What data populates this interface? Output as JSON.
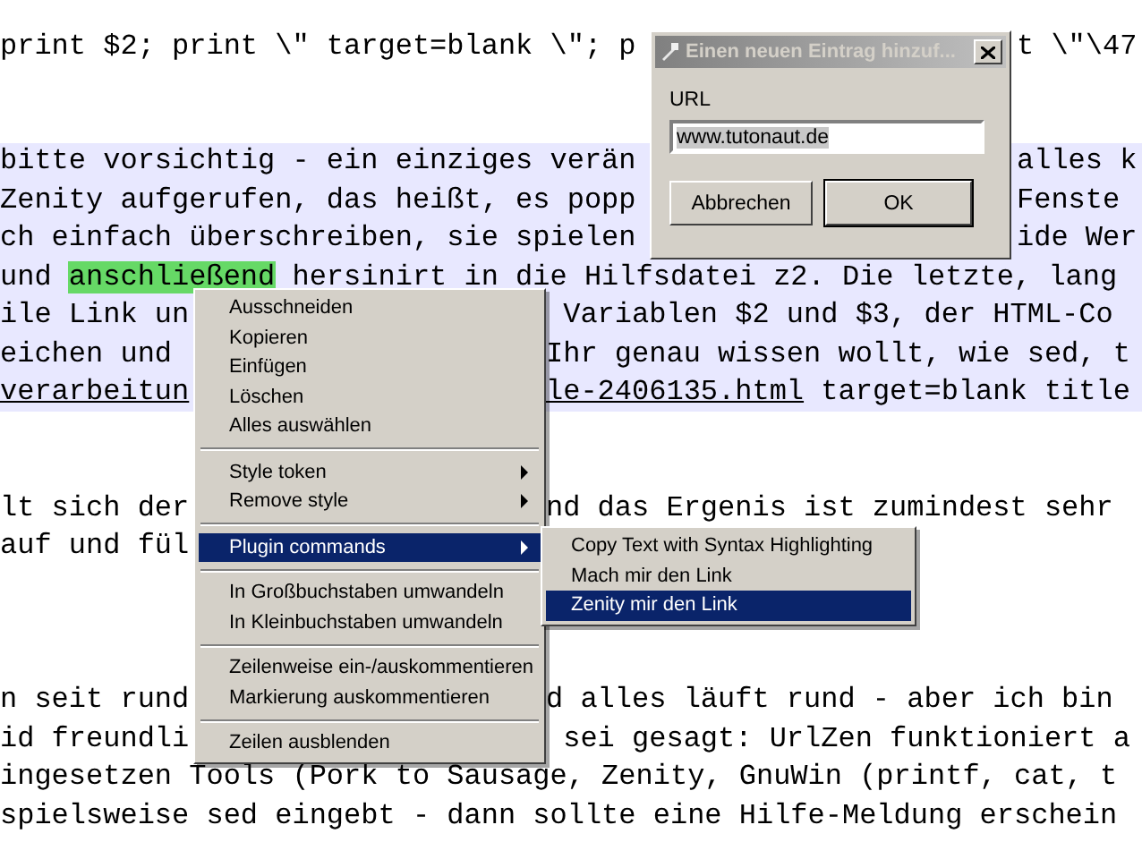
{
  "editor": {
    "lines": [
      {
        "marked": false,
        "parts": [
          {
            "text": "print $2; print \\\" target=blank \\\"; p",
            "kind": "text"
          }
        ],
        "right": [
          {
            "text": "t \\\"\\47",
            "kind": "text"
          }
        ]
      },
      {
        "marked": false
      },
      {
        "marked": false
      },
      {
        "marked": true,
        "parts": [
          {
            "text": "bitte vorsichtig - ein einziges verän",
            "kind": "text"
          }
        ],
        "right": [
          {
            "text": "alles k",
            "kind": "text"
          }
        ]
      },
      {
        "marked": true,
        "parts": [
          {
            "text": "Zenity aufgerufen, das heißt, es popp",
            "kind": "text"
          }
        ],
        "right": [
          {
            "text": "Fenste",
            "kind": "text"
          }
        ]
      },
      {
        "marked": true,
        "parts": [
          {
            "text": "ch einfach überschreiben, sie spielen",
            "kind": "text"
          }
        ],
        "right": [
          {
            "text": "ide Wer",
            "kind": "text"
          }
        ]
      },
      {
        "marked": true,
        "parts": [
          {
            "text": "und ",
            "kind": "text"
          },
          {
            "text": "anschließend",
            "kind": "token"
          },
          {
            "text": " hersinirt in die Hilfsdatei z2. Die letzte, lang",
            "kind": "text"
          }
        ]
      },
      {
        "marked": true,
        "parts": [
          {
            "text": "ile Link un",
            "kind": "text"
          }
        ],
        "right": [
          {
            "text": " Variablen $2 und $3, der HTML-Co",
            "kind": "text"
          }
        ]
      },
      {
        "marked": true,
        "parts": [
          {
            "text": "eichen und",
            "kind": "text"
          }
        ],
        "right": [
          {
            "text": "Ihr genau wissen wollt, wie sed, t",
            "kind": "text"
          }
        ]
      },
      {
        "marked": true,
        "parts": [
          {
            "text": "verarbeitun",
            "kind": "link"
          }
        ],
        "right": [
          {
            "text": "le-2406135.html",
            "kind": "link"
          },
          {
            "text": " target=blank title",
            "kind": "text"
          }
        ]
      },
      {
        "marked": false
      },
      {
        "marked": false
      },
      {
        "marked": false,
        "parts": [
          {
            "text": "lt sich der",
            "kind": "text"
          }
        ],
        "right": [
          {
            "text": "nd das Ergenis ist zumindest sehr",
            "kind": "text"
          }
        ]
      },
      {
        "marked": false,
        "parts": [
          {
            "text": "auf und fül",
            "kind": "text"
          }
        ]
      },
      {
        "marked": false
      },
      {
        "marked": false
      },
      {
        "marked": false
      },
      {
        "marked": false,
        "parts": [
          {
            "text": "n seit rund",
            "kind": "text"
          }
        ],
        "right": [
          {
            "text": "d alles läuft rund - aber ich bin",
            "kind": "text"
          }
        ]
      },
      {
        "marked": false,
        "parts": [
          {
            "text": "id freundli",
            "kind": "text"
          }
        ],
        "right": [
          {
            "text": " sei gesagt: UrlZen funktioniert a",
            "kind": "text"
          }
        ]
      },
      {
        "marked": false,
        "parts": [
          {
            "text": "ingesetzen Tools (Pork to Sausage, Zenity, GnuWin (printf, cat, t",
            "kind": "text"
          }
        ]
      },
      {
        "marked": false,
        "parts": [
          {
            "text": "spielsweise sed eingebt - dann sollte eine Hilfe-Meldung erschein",
            "kind": "text"
          }
        ]
      }
    ]
  },
  "context_menu": {
    "items": [
      {
        "kind": "item",
        "label": "Ausschneiden",
        "submenu": false,
        "selected": false
      },
      {
        "kind": "item",
        "label": "Kopieren",
        "submenu": false,
        "selected": false
      },
      {
        "kind": "item",
        "label": "Einfügen",
        "submenu": false,
        "selected": false
      },
      {
        "kind": "item",
        "label": "Löschen",
        "submenu": false,
        "selected": false
      },
      {
        "kind": "item",
        "label": "Alles auswählen",
        "submenu": false,
        "selected": false
      },
      {
        "kind": "separator"
      },
      {
        "kind": "item",
        "label": "Style token",
        "submenu": true,
        "selected": false
      },
      {
        "kind": "item",
        "label": "Remove style",
        "submenu": true,
        "selected": false
      },
      {
        "kind": "separator"
      },
      {
        "kind": "item",
        "label": "Plugin commands",
        "submenu": true,
        "selected": true
      },
      {
        "kind": "separator"
      },
      {
        "kind": "item",
        "label": "In Großbuchstaben umwandeln",
        "submenu": false,
        "selected": false
      },
      {
        "kind": "item",
        "label": "In Kleinbuchstaben umwandeln",
        "submenu": false,
        "selected": false
      },
      {
        "kind": "separator"
      },
      {
        "kind": "item",
        "label": "Zeilenweise ein-/auskommentieren",
        "submenu": false,
        "selected": false
      },
      {
        "kind": "item",
        "label": "Markierung auskommentieren",
        "submenu": false,
        "selected": false
      },
      {
        "kind": "separator"
      },
      {
        "kind": "item",
        "label": "Zeilen ausblenden",
        "submenu": false,
        "selected": false
      }
    ]
  },
  "submenu": {
    "items": [
      {
        "label": "Copy Text with Syntax Highlighting",
        "selected": false
      },
      {
        "label": "Mach mir den Link",
        "selected": false
      },
      {
        "label": "Zenity mir den Link",
        "selected": true
      }
    ]
  },
  "dialog": {
    "title": "Einen neuen Eintrag hinzuf...",
    "field_label": "URL",
    "url": "www.tutonaut.de",
    "buttons": [
      {
        "label": "Abbrechen",
        "default": false
      },
      {
        "label": "OK",
        "default": true
      }
    ]
  }
}
